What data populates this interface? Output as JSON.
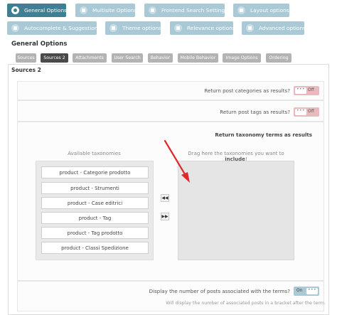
{
  "top_tabs": [
    {
      "label": "General Options",
      "icon": "gear-icon",
      "active": true
    },
    {
      "label": "Multisite Options",
      "icon": "grid-icon",
      "active": false
    },
    {
      "label": "Frontend Search Settings",
      "icon": "grid-icon",
      "active": false
    },
    {
      "label": "Layout options",
      "icon": "layout-icon",
      "active": false
    },
    {
      "label": "Autocomplete & Suggestions",
      "icon": "pin-icon",
      "active": false
    },
    {
      "label": "Theme options",
      "icon": "eye-icon",
      "active": false
    },
    {
      "label": "Relevance options",
      "icon": "gear-icon",
      "active": false
    },
    {
      "label": "Advanced options",
      "icon": "gear-icon",
      "active": false
    }
  ],
  "section_title": "General Options",
  "sub_tabs": [
    {
      "label": "Sources",
      "active": false
    },
    {
      "label": "Sources 2",
      "active": true
    },
    {
      "label": "Attachments",
      "active": false
    },
    {
      "label": "User Search",
      "active": false
    },
    {
      "label": "Behavior",
      "active": false
    },
    {
      "label": "Mobile Behavior",
      "active": false
    },
    {
      "label": "Image Options",
      "active": false
    },
    {
      "label": "Ordering",
      "active": false
    }
  ],
  "panel_title": "Sources 2",
  "settings": {
    "post_categories": {
      "label": "Return post categories as results?",
      "toggle": "Off",
      "knob": "•••"
    },
    "post_tags": {
      "label": "Return post tags as results?",
      "toggle": "Off",
      "knob": "•••"
    },
    "taxonomy_heading": "Return taxonomy terms as results",
    "posts_count": {
      "label": "Display the number of posts associated with the terms?",
      "toggle": "On",
      "knob": "•••",
      "hint": "Will display the number of associated posts in a bracket after the term."
    }
  },
  "available": {
    "title": "Available taxonomies",
    "items": [
      "product - Categorie prodotto",
      "product - Strumenti",
      "product - Case editrici",
      "product - Tag",
      "product - Tag prodotto",
      "product - Classi Spedizione"
    ]
  },
  "drop_zone": {
    "title_prefix": "Drag here the taxonomies you want to ",
    "title_bold": "include",
    "title_suffix": "!"
  },
  "move_buttons": {
    "left": "◀◀",
    "right": "▶▶"
  },
  "colors": {
    "active_tab": "#3f7f93",
    "inactive_tab": "#a9c9d6",
    "toggle_off": "#e8b9bd",
    "toggle_on": "#a9c9d6",
    "arrow": "#e0262e"
  }
}
